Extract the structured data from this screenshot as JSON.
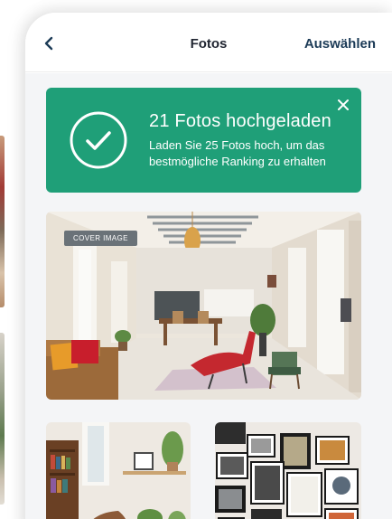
{
  "header": {
    "back_icon": "chevron-left-icon",
    "title": "Fotos",
    "select_label": "Auswählen"
  },
  "banner": {
    "title": "21 Fotos hochgeladen",
    "subtitle": "Laden Sie 25 Fotos hoch, um das bestmögliche Ranking zu erhalten",
    "icon": "check-circle-icon",
    "close_icon": "close-icon",
    "background": "#1f9f78"
  },
  "photos": {
    "cover_badge": "COVER IMAGE"
  },
  "colors": {
    "accent": "#1c3b57",
    "success": "#1f9f78"
  }
}
